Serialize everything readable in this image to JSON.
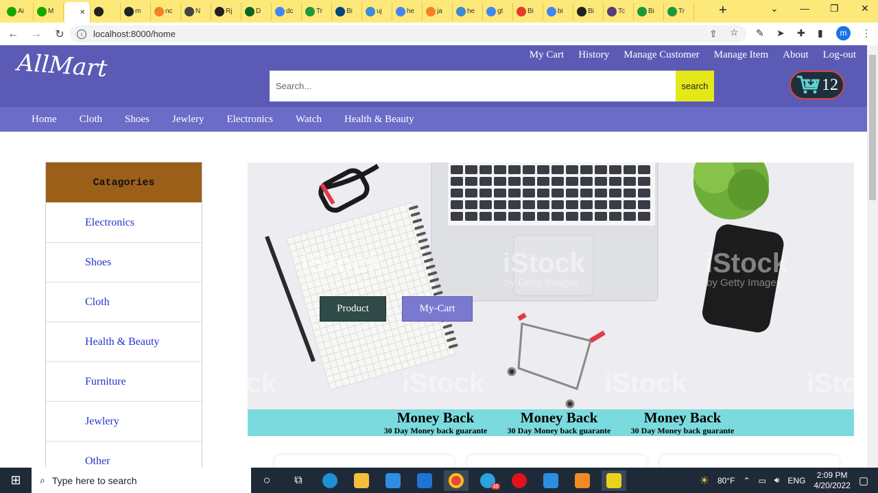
{
  "browser": {
    "tabs": [
      {
        "label": "Ai",
        "color": "#14a800"
      },
      {
        "label": "M",
        "color": "#14a800"
      },
      {
        "label": "",
        "color": "#ffffff",
        "active": true
      },
      {
        "label": "",
        "color": "#222222"
      },
      {
        "label": "m",
        "color": "#222222"
      },
      {
        "label": "nc",
        "color": "#f48024"
      },
      {
        "label": "N",
        "color": "#444444"
      },
      {
        "label": "Rj",
        "color": "#222222"
      },
      {
        "label": "D",
        "color": "#0b6623"
      },
      {
        "label": "dc",
        "color": "#4285f4"
      },
      {
        "label": "Tr",
        "color": "#1a9b3a"
      },
      {
        "label": "Bi",
        "color": "#00457c"
      },
      {
        "label": "uj",
        "color": "#3b8bd6"
      },
      {
        "label": "he",
        "color": "#4285f4"
      },
      {
        "label": "ja",
        "color": "#f48024"
      },
      {
        "label": "he",
        "color": "#3b8bd6"
      },
      {
        "label": "gt",
        "color": "#4285f4"
      },
      {
        "label": "Bi",
        "color": "#e23c2a"
      },
      {
        "label": "bi",
        "color": "#4285f4"
      },
      {
        "label": "Bi",
        "color": "#222222"
      },
      {
        "label": "Tc",
        "color": "#563d7c"
      },
      {
        "label": "Bi",
        "color": "#1a9b3a"
      },
      {
        "label": "Tr",
        "color": "#1a9b3a"
      }
    ],
    "close_glyph": "✕",
    "new_tab_glyph": "+",
    "url": "localhost:8000/home"
  },
  "site": {
    "logo": "AllMart",
    "top_links": [
      "My Cart",
      "History",
      "Manage Customer",
      "Manage Item",
      "About",
      "Log-out"
    ],
    "search": {
      "placeholder": "Search...",
      "button": "search"
    },
    "cart_count": "12",
    "categories_nav": [
      "Home",
      "Cloth",
      "Shoes",
      "Jewlery",
      "Electronics",
      "Watch",
      "Health & Beauty"
    ],
    "sidebar": {
      "title": "Catagories",
      "items": [
        "Electronics",
        "Shoes",
        "Cloth",
        "Health & Beauty",
        "Furniture",
        "Jewlery",
        "Other"
      ]
    },
    "hero": {
      "product_button": "Product",
      "mycart_button": "My-Cart",
      "watermark": "iStock",
      "watermark_sub": "by Getty Images"
    },
    "money_back": [
      {
        "title": "Money Back",
        "subtitle": "30 Day Money back guarante"
      },
      {
        "title": "Money Back",
        "subtitle": "30 Day Money back guarante"
      },
      {
        "title": "Money Back",
        "subtitle": "30 Day Money back guarante"
      }
    ]
  },
  "taskbar": {
    "search_placeholder": "Type here to search",
    "weather": "80°F",
    "language": "ENG",
    "time": "2:09 PM",
    "date": "4/20/2022",
    "telegram_badge": "49"
  },
  "colors": {
    "header": "#5b5bb5",
    "catnav": "#6b6bc8",
    "sidebar_head": "#9c5f1a",
    "search_button": "#e4e81a",
    "money_back_bar": "#7bdadd"
  }
}
